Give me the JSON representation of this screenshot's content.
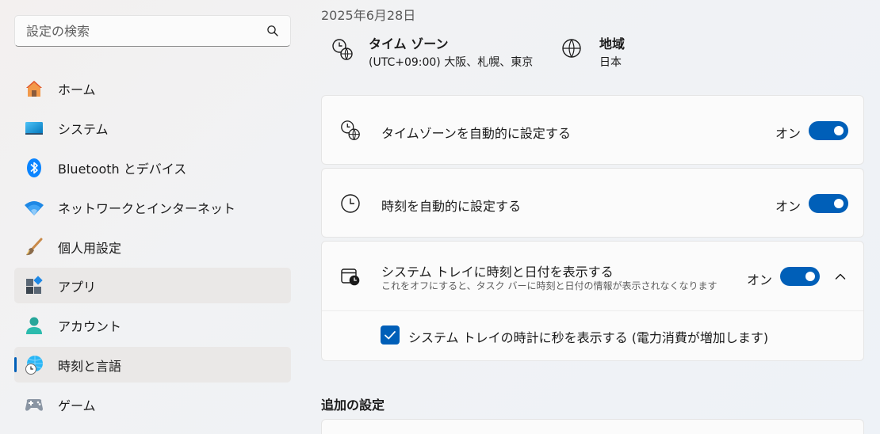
{
  "sidebar": {
    "search": {
      "placeholder": "設定の検索",
      "icon": "search-icon"
    },
    "items": [
      {
        "label": "ホーム",
        "icon": "home-icon"
      },
      {
        "label": "システム",
        "icon": "system-icon"
      },
      {
        "label": "Bluetooth とデバイス",
        "icon": "bluetooth-icon"
      },
      {
        "label": "ネットワークとインターネット",
        "icon": "wifi-icon"
      },
      {
        "label": "個人用設定",
        "icon": "brush-icon"
      },
      {
        "label": "アプリ",
        "icon": "apps-icon"
      },
      {
        "label": "アカウント",
        "icon": "account-icon"
      },
      {
        "label": "時刻と言語",
        "icon": "time-language-icon",
        "selected": true
      },
      {
        "label": "ゲーム",
        "icon": "gamepad-icon"
      }
    ]
  },
  "main": {
    "date": "2025年6月28日",
    "timezone": {
      "title": "タイム ゾーン",
      "value": "(UTC+09:00) 大阪、札幌、東京",
      "icon": "clock-globe-icon"
    },
    "region": {
      "title": "地域",
      "value": "日本",
      "icon": "globe-icon"
    },
    "settings": [
      {
        "title": "タイムゾーンを自動的に設定する",
        "state": "オン",
        "on": true,
        "icon": "clock-globe-icon"
      },
      {
        "title": "時刻を自動的に設定する",
        "state": "オン",
        "on": true,
        "icon": "clock-icon"
      },
      {
        "title": "システム トレイに時刻と日付を表示する",
        "subtitle": "これをオフにすると、タスク バーに時刻と日付の情報が表示されなくなります",
        "state": "オン",
        "on": true,
        "expanded": true,
        "icon": "calendar-clock-icon",
        "option": {
          "label": "システム トレイの時計に秒を表示する (電力消費が増加します)",
          "checked": true
        }
      }
    ],
    "additional_heading": "追加の設定"
  },
  "colors": {
    "accent": "#005fb8",
    "card": "#fbfbfb",
    "selected": "#eae8e7"
  }
}
